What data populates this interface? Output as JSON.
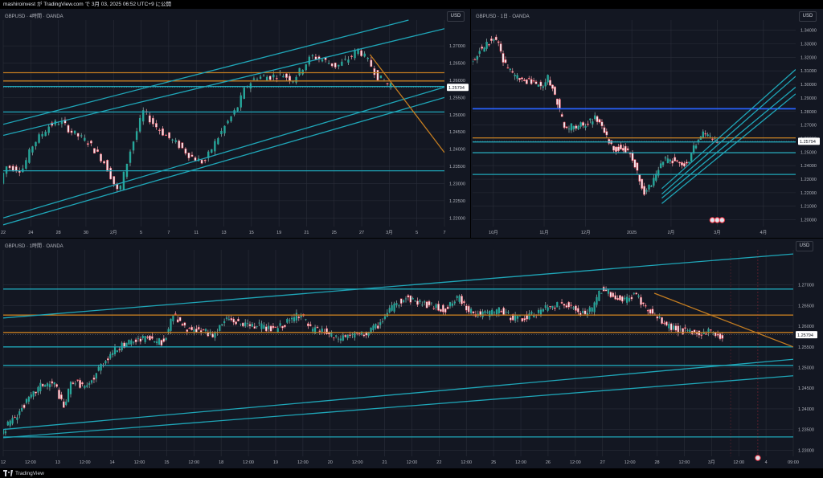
{
  "header": {
    "title": "mashiroinvest が TradingView.com で 3月 03, 2025 06:52 UTC+9 に公開"
  },
  "footer": {
    "brand": "TradingView"
  },
  "colors": {
    "bg": "#131722",
    "up": "#26a69a",
    "down": "#f23645",
    "teal": "#1fa6b8",
    "orange": "#c47d21",
    "blue": "#2962ff",
    "grid": "#2a2e39",
    "text": "#b2b5be",
    "wickUp": "#9ab8b3",
    "wickDown": "#f0a0aa"
  },
  "chart_data": [
    {
      "type": "candlestick",
      "title": "GBPUSD · 4時間 · OANDA",
      "currency": "USD",
      "last_price": "1.25794",
      "ylim": [
        1.2175,
        1.2775
      ],
      "y_ticks": [
        "1.27000",
        "1.26500",
        "1.26000",
        "1.25500",
        "1.25000",
        "1.24500",
        "1.24000",
        "1.23500",
        "1.23000",
        "1.22500",
        "1.22000"
      ],
      "x_ticks": [
        "22",
        "24",
        "28",
        "30",
        "2月",
        "5",
        "7",
        "11",
        "13",
        "15",
        "19",
        "21",
        "25",
        "27",
        "3月",
        "5",
        "7"
      ],
      "x_range": [
        0,
        16
      ],
      "x_tick_positions": [
        0,
        1,
        2,
        3,
        4,
        5,
        6,
        7,
        8,
        9,
        10,
        11,
        12,
        13,
        14,
        15,
        16
      ],
      "candle_x_range": [
        0,
        14.05
      ],
      "price_path": [
        [
          0,
          1.23
        ],
        [
          0.2,
          1.235
        ],
        [
          0.8,
          1.234
        ],
        [
          1.2,
          1.2415
        ],
        [
          1.8,
          1.247
        ],
        [
          2.2,
          1.248
        ],
        [
          2.6,
          1.245
        ],
        [
          3.2,
          1.242
        ],
        [
          3.8,
          1.236
        ],
        [
          4.3,
          1.227
        ],
        [
          4.7,
          1.239
        ],
        [
          5.2,
          1.251
        ],
        [
          5.6,
          1.247
        ],
        [
          6.0,
          1.244
        ],
        [
          6.5,
          1.241
        ],
        [
          6.9,
          1.238
        ],
        [
          7.4,
          1.236
        ],
        [
          7.8,
          1.242
        ],
        [
          8.1,
          1.246
        ],
        [
          8.6,
          1.252
        ],
        [
          8.9,
          1.258
        ],
        [
          9.3,
          1.261
        ],
        [
          9.8,
          1.261
        ],
        [
          10.2,
          1.262
        ],
        [
          10.6,
          1.26
        ],
        [
          11.0,
          1.264
        ],
        [
          11.3,
          1.267
        ],
        [
          11.7,
          1.266
        ],
        [
          12.2,
          1.264
        ],
        [
          12.6,
          1.266
        ],
        [
          13.0,
          1.269
        ],
        [
          13.4,
          1.265
        ],
        [
          13.7,
          1.261
        ],
        [
          14.05,
          1.259
        ]
      ],
      "levels": [
        {
          "color": "orange",
          "y": 1.2622
        },
        {
          "color": "orange",
          "y": 1.2598
        },
        {
          "color": "teal",
          "y": 1.2582
        },
        {
          "color": "teal",
          "y": 1.2508
        },
        {
          "color": "teal",
          "y": 1.2337
        }
      ],
      "trendlines": [
        {
          "color": "teal",
          "p1": [
            0,
            1.2472
          ],
          "p2": [
            14.7,
            1.2775
          ]
        },
        {
          "color": "teal",
          "p1": [
            0,
            1.244
          ],
          "p2": [
            16,
            1.275
          ]
        },
        {
          "color": "teal",
          "p1": [
            0,
            1.22
          ],
          "p2": [
            16,
            1.258
          ]
        },
        {
          "color": "teal",
          "p1": [
            0,
            1.218
          ],
          "p2": [
            16,
            1.255
          ]
        },
        {
          "color": "orange",
          "p1": [
            13.3,
            1.2675
          ],
          "p2": [
            16,
            1.239
          ]
        }
      ],
      "flags": 0
    },
    {
      "type": "candlestick",
      "title": "GBPUSD · 1日 · OANDA",
      "currency": "USD",
      "last_price": "1.25794",
      "ylim": [
        1.195,
        1.3475
      ],
      "y_ticks": [
        "1.34000",
        "1.33000",
        "1.32000",
        "1.31000",
        "1.30000",
        "1.29000",
        "1.28000",
        "1.27000",
        "1.26000",
        "1.25000",
        "1.24000",
        "1.23000",
        "1.22000",
        "1.21000",
        "1.20000"
      ],
      "x_ticks": [
        "10月",
        "11月",
        "12月",
        "2025",
        "2月",
        "3月",
        "4月"
      ],
      "x_range": [
        0,
        7
      ],
      "x_tick_positions": [
        0.45,
        1.55,
        2.45,
        3.45,
        4.3,
        5.3,
        6.3
      ],
      "candle_x_range": [
        0,
        5.3
      ],
      "price_path": [
        [
          0,
          1.314
        ],
        [
          0.2,
          1.325
        ],
        [
          0.35,
          1.33
        ],
        [
          0.5,
          1.335
        ],
        [
          0.6,
          1.33
        ],
        [
          0.75,
          1.315
        ],
        [
          0.9,
          1.308
        ],
        [
          1.05,
          1.305
        ],
        [
          1.2,
          1.303
        ],
        [
          1.4,
          1.3
        ],
        [
          1.55,
          1.3
        ],
        [
          1.7,
          1.305
        ],
        [
          1.8,
          1.295
        ],
        [
          1.9,
          1.285
        ],
        [
          2.0,
          1.272
        ],
        [
          2.1,
          1.265
        ],
        [
          2.2,
          1.27
        ],
        [
          2.35,
          1.269
        ],
        [
          2.55,
          1.272
        ],
        [
          2.7,
          1.275
        ],
        [
          2.8,
          1.272
        ],
        [
          2.95,
          1.262
        ],
        [
          3.1,
          1.252
        ],
        [
          3.3,
          1.254
        ],
        [
          3.4,
          1.25
        ],
        [
          3.55,
          1.243
        ],
        [
          3.65,
          1.23
        ],
        [
          3.75,
          1.22
        ],
        [
          3.85,
          1.223
        ],
        [
          4.0,
          1.232
        ],
        [
          4.15,
          1.242
        ],
        [
          4.3,
          1.246
        ],
        [
          4.45,
          1.243
        ],
        [
          4.6,
          1.24
        ],
        [
          4.75,
          1.245
        ],
        [
          4.85,
          1.255
        ],
        [
          5.0,
          1.262
        ],
        [
          5.15,
          1.264
        ],
        [
          5.3,
          1.258
        ]
      ],
      "levels": [
        {
          "color": "blue",
          "y": 1.282
        },
        {
          "color": "orange",
          "y": 1.2605
        },
        {
          "color": "teal",
          "y": 1.2575
        },
        {
          "color": "teal",
          "y": 1.2495
        },
        {
          "color": "teal",
          "y": 1.2335
        }
      ],
      "trendlines": [
        {
          "color": "teal",
          "p1": [
            4.1,
            1.223
          ],
          "p2": [
            7,
            1.311
          ]
        },
        {
          "color": "teal",
          "p1": [
            4.1,
            1.219
          ],
          "p2": [
            7,
            1.306
          ]
        },
        {
          "color": "teal",
          "p1": [
            4.1,
            1.216
          ],
          "p2": [
            7,
            1.298
          ]
        },
        {
          "color": "teal",
          "p1": [
            4.1,
            1.212
          ],
          "p2": [
            7,
            1.293
          ]
        }
      ],
      "flags": 3
    },
    {
      "type": "candlestick",
      "title": "GBPUSD · 1時間 · OANDA",
      "currency": "USD",
      "last_price": "1.25794",
      "ylim": [
        1.2285,
        1.2785
      ],
      "y_ticks": [
        "1.27000",
        "1.26500",
        "1.26000",
        "1.25500",
        "1.25000",
        "1.24500",
        "1.24000",
        "1.23500",
        "1.23000"
      ],
      "x_ticks": [
        "12",
        "12:00",
        "13",
        "12:00",
        "14",
        "12:00",
        "15",
        "12:00",
        "18",
        "12:00",
        "19",
        "12:00",
        "20",
        "12:00",
        "21",
        "12:00",
        "22",
        "12:00",
        "25",
        "12:00",
        "26",
        "12:00",
        "27",
        "12:00",
        "28",
        "12:00",
        "3月",
        "12:00",
        "4",
        "09:00"
      ],
      "x_range": [
        0,
        29
      ],
      "x_tick_positions": [
        0,
        1,
        2,
        3,
        4,
        5,
        6,
        7,
        8,
        9,
        10,
        11,
        12,
        13,
        14,
        15,
        16,
        17,
        18,
        19,
        20,
        21,
        22,
        23,
        24,
        25,
        26,
        27,
        28,
        29
      ],
      "candle_x_range": [
        0,
        26.4
      ],
      "price_path": [
        [
          0,
          1.234
        ],
        [
          0.5,
          1.238
        ],
        [
          1.0,
          1.242
        ],
        [
          1.5,
          1.246
        ],
        [
          2.0,
          1.246
        ],
        [
          2.3,
          1.24
        ],
        [
          2.6,
          1.247
        ],
        [
          3.2,
          1.245
        ],
        [
          3.6,
          1.25
        ],
        [
          4.1,
          1.254
        ],
        [
          4.7,
          1.256
        ],
        [
          5.3,
          1.257
        ],
        [
          6.0,
          1.256
        ],
        [
          6.3,
          1.263
        ],
        [
          6.8,
          1.259
        ],
        [
          7.3,
          1.259
        ],
        [
          7.8,
          1.258
        ],
        [
          8.3,
          1.262
        ],
        [
          9.0,
          1.26
        ],
        [
          9.5,
          1.26
        ],
        [
          10.0,
          1.259
        ],
        [
          10.5,
          1.261
        ],
        [
          11.0,
          1.263
        ],
        [
          11.4,
          1.259
        ],
        [
          11.8,
          1.259
        ],
        [
          12.3,
          1.257
        ],
        [
          12.8,
          1.258
        ],
        [
          13.3,
          1.258
        ],
        [
          13.8,
          1.26
        ],
        [
          14.3,
          1.264
        ],
        [
          14.8,
          1.267
        ],
        [
          15.3,
          1.266
        ],
        [
          15.8,
          1.265
        ],
        [
          16.3,
          1.264
        ],
        [
          16.8,
          1.267
        ],
        [
          17.3,
          1.263
        ],
        [
          17.8,
          1.263
        ],
        [
          18.3,
          1.264
        ],
        [
          18.8,
          1.262
        ],
        [
          19.3,
          1.262
        ],
        [
          19.8,
          1.264
        ],
        [
          20.3,
          1.265
        ],
        [
          20.8,
          1.265
        ],
        [
          21.3,
          1.263
        ],
        [
          21.7,
          1.264
        ],
        [
          22.0,
          1.269
        ],
        [
          22.3,
          1.268
        ],
        [
          22.8,
          1.266
        ],
        [
          23.3,
          1.268
        ],
        [
          23.7,
          1.264
        ],
        [
          24.1,
          1.262
        ],
        [
          24.5,
          1.26
        ],
        [
          25.0,
          1.259
        ],
        [
          25.5,
          1.258
        ],
        [
          26.0,
          1.259
        ],
        [
          26.4,
          1.2575
        ]
      ],
      "levels": [
        {
          "color": "teal",
          "y": 1.269
        },
        {
          "color": "orange",
          "y": 1.2627
        },
        {
          "color": "orange",
          "y": 1.2585
        },
        {
          "color": "teal",
          "y": 1.255
        },
        {
          "color": "teal",
          "y": 1.2505
        },
        {
          "color": "teal",
          "y": 1.2332
        }
      ],
      "trendlines": [
        {
          "color": "teal",
          "p1": [
            0,
            1.262
          ],
          "p2": [
            29,
            1.2775
          ]
        },
        {
          "color": "teal",
          "p1": [
            0,
            1.235
          ],
          "p2": [
            29,
            1.252
          ]
        },
        {
          "color": "teal",
          "p1": [
            0,
            1.233
          ],
          "p2": [
            29,
            1.248
          ]
        },
        {
          "color": "orange",
          "p1": [
            23.9,
            1.268
          ],
          "p2": [
            29,
            1.255
          ]
        }
      ],
      "flags": 1
    }
  ]
}
